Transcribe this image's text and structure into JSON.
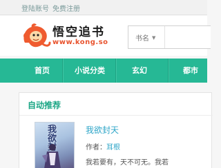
{
  "topbar": {
    "login": "登陆账号",
    "register": "免费注册"
  },
  "logo": {
    "name": "悟空追书",
    "url": "www.kong.so"
  },
  "search": {
    "category": "书名",
    "placeholder": ""
  },
  "nav": {
    "items": [
      {
        "label": "首页"
      },
      {
        "label": "小说分类"
      },
      {
        "label": "玄幻"
      },
      {
        "label": "都市"
      }
    ]
  },
  "section": {
    "title": "自动推荐"
  },
  "book": {
    "cover_text": "我欲封天",
    "title": "我欲封天",
    "author_label": "作者：",
    "author": "耳根",
    "description": "我若要有，天不可无。我若"
  },
  "colors": {
    "accent": "#26b895",
    "link": "#2fa6c8",
    "logo_url": "#e8532e"
  }
}
